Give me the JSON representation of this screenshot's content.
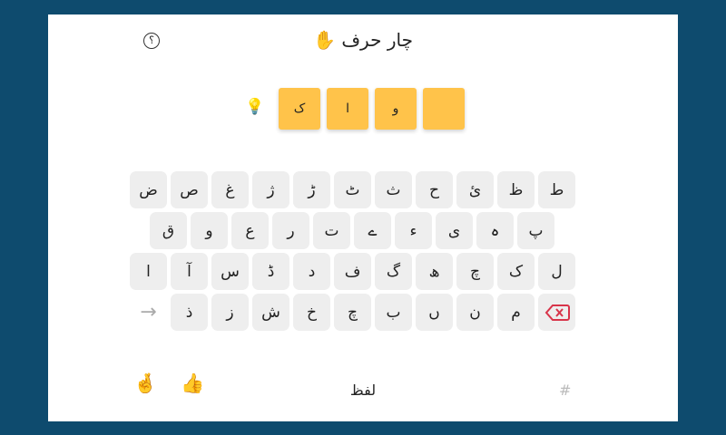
{
  "header": {
    "title": "چار حرف",
    "title_emoji": "✋",
    "help_label": "؟"
  },
  "hint_icon": "lightbulb-icon",
  "hint_glyph": "💡",
  "tiles": [
    "ک",
    "ا",
    "و",
    ""
  ],
  "keyboard": {
    "row1": [
      "ط",
      "ظ",
      "ئ",
      "ح",
      "ث",
      "ٹ",
      "ڑ",
      "ژ",
      "غ",
      "ص",
      "ض"
    ],
    "row2": [
      "پ",
      "ہ",
      "ی",
      "ء",
      "ے",
      "ت",
      "ر",
      "ع",
      "و",
      "ق"
    ],
    "row3": [
      "ل",
      "ک",
      "چ",
      "ھ",
      "گ",
      "ف",
      "د",
      "ڈ",
      "س",
      "آ",
      "ا"
    ],
    "row4": [
      "⌫",
      "م",
      "ن",
      "ں",
      "ب",
      "چ",
      "خ",
      "ش",
      "ز",
      "ذ",
      "→"
    ]
  },
  "footer": {
    "word_label": "لفظ",
    "hash_label": "#",
    "left_emoji": "🤞",
    "right_emoji": "👍"
  },
  "colors": {
    "background": "#0e4b6e",
    "tile": "#ffc34a",
    "key": "#eeeeee",
    "backspace": "#d8344a"
  }
}
